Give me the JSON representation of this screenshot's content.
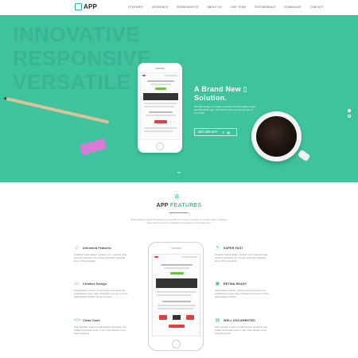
{
  "nav": {
    "logo": "APP",
    "items": [
      "FEATURES",
      "INTERFACE",
      "SCREENSHOTS",
      "ABOUT US",
      "OUR TEAM",
      "TESTIMONIALS",
      "DOWNLOAD",
      "CONTACT"
    ]
  },
  "hero": {
    "bg_words": [
      "INNOVATIVE",
      "RESPONSIVE",
      "VERSATILE"
    ],
    "title_line1": "A Brand New",
    "title_line2": "Solution.",
    "text": "We take things to a totally new level with the highly usable and affordable app. This will be what you need to get on your way!",
    "button_label": "GET OUR APP",
    "button_icons": [
      "apple-icon",
      "android-icon",
      "windows-icon"
    ],
    "slider_dots": 2,
    "active_dot": 0
  },
  "features": {
    "heading_part1": "APP",
    "heading_part2": "FEATURES",
    "intro": "Suspendisse potenti Phasellus euismod libero in neque molestie et mentum libero. Quisque diam, id est in enim, vestibulum consectetur nunc vitae dolor.",
    "left": [
      {
        "icon": "diamond-icon",
        "title": "Unlimited Features",
        "text": "Curabitur ligula sapien, tincidunt non, euismod vitae, posuere imperdiet, leo. Donec venenatis vulputate lorem. Proin faucibus."
      },
      {
        "icon": "laptop-icon",
        "title": "Creative Design",
        "text": "Suspendisse nisl elit, rhoncus eget, elementum ac, condimentum eget, diam. Phasellus nec sem in justo pellentesque facilisis. Donec posuere."
      },
      {
        "icon": "code-icon",
        "title": "Clean Code",
        "text": "Nam egestas, augue ut pellentesque hendrerit, erat. Nullam accumsan lorem in dui. Cras ultricies mi eu turpis hendrerit."
      }
    ],
    "right": [
      {
        "icon": "bolt-icon",
        "title": "SUPER FAST",
        "text": "Curabitur ligula sapien, tincidunt non, euismod vitae, posuere imperdiet, leo. Donec venenatis vulputate lorem. Proin faucibus."
      },
      {
        "icon": "monitor-icon",
        "title": "RETINA READY",
        "text": "Suspendisse nisl elit, rhoncus eget, elementum ac, condimentum eget, diam. Phasellus nec sem in justo pellentesque facilisis."
      },
      {
        "icon": "book-icon",
        "title": "WELL DOCUMENTED",
        "text": "Nam egestas, augue ut pellentesque hendrerit, erat. Nullam accumsan lorem in dui. Cras ultricies mi eu turpis hendrerit."
      }
    ]
  },
  "colors": {
    "accent": "#3fc39d",
    "hero_bg": "#3fc39d",
    "text_dark": "#333333"
  }
}
